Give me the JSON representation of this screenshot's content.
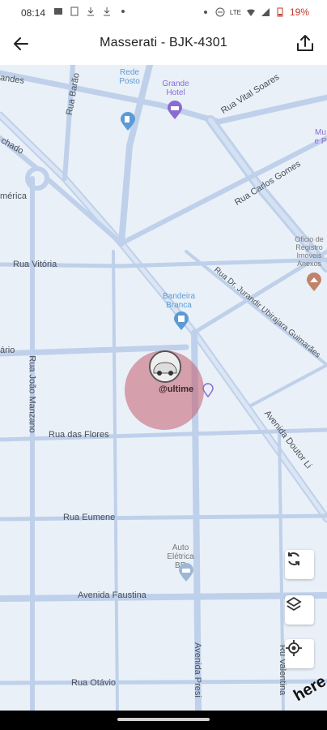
{
  "status": {
    "time": "08:14",
    "battery": "19%",
    "network": "LTE"
  },
  "header": {
    "title": "Masserati - BJK-4301"
  },
  "map": {
    "streets": [
      "andes",
      "Rua Barão",
      "Rede Posto",
      "Grande Hotel",
      "Rua Vital Soares",
      "chado",
      "mérica",
      "Rua Carlos Gomes",
      "Rua Vitória",
      "Rua Dr. Jurandir Ubirajara Guimarães",
      "Bandeira Branca",
      "ário",
      "Rua João Manzano",
      "Avenida Doutor Li",
      "Rua das Flores",
      "Rua Eumene",
      "Auto Elétrica BR",
      "Avenida Faustina",
      "Avenida Presi",
      "Rua Otávio",
      "Ru Valentina"
    ],
    "poi_museum": "Mu e P",
    "poi_registry": "Oficio de Registro Imóveis Anexos",
    "marker_label": "@ultime",
    "watermark": "here"
  },
  "colors": {
    "road": "#bfd0ea",
    "map_bg": "#e9f0f8",
    "radius": "#c45c6e",
    "poi_blue": "#5b9bd5",
    "poi_purple": "#8a6bd1"
  },
  "icons": {
    "back": "arrow-left-icon",
    "share": "share-icon",
    "refresh": "refresh-icon",
    "layers": "layers-icon",
    "locate": "locate-icon"
  }
}
